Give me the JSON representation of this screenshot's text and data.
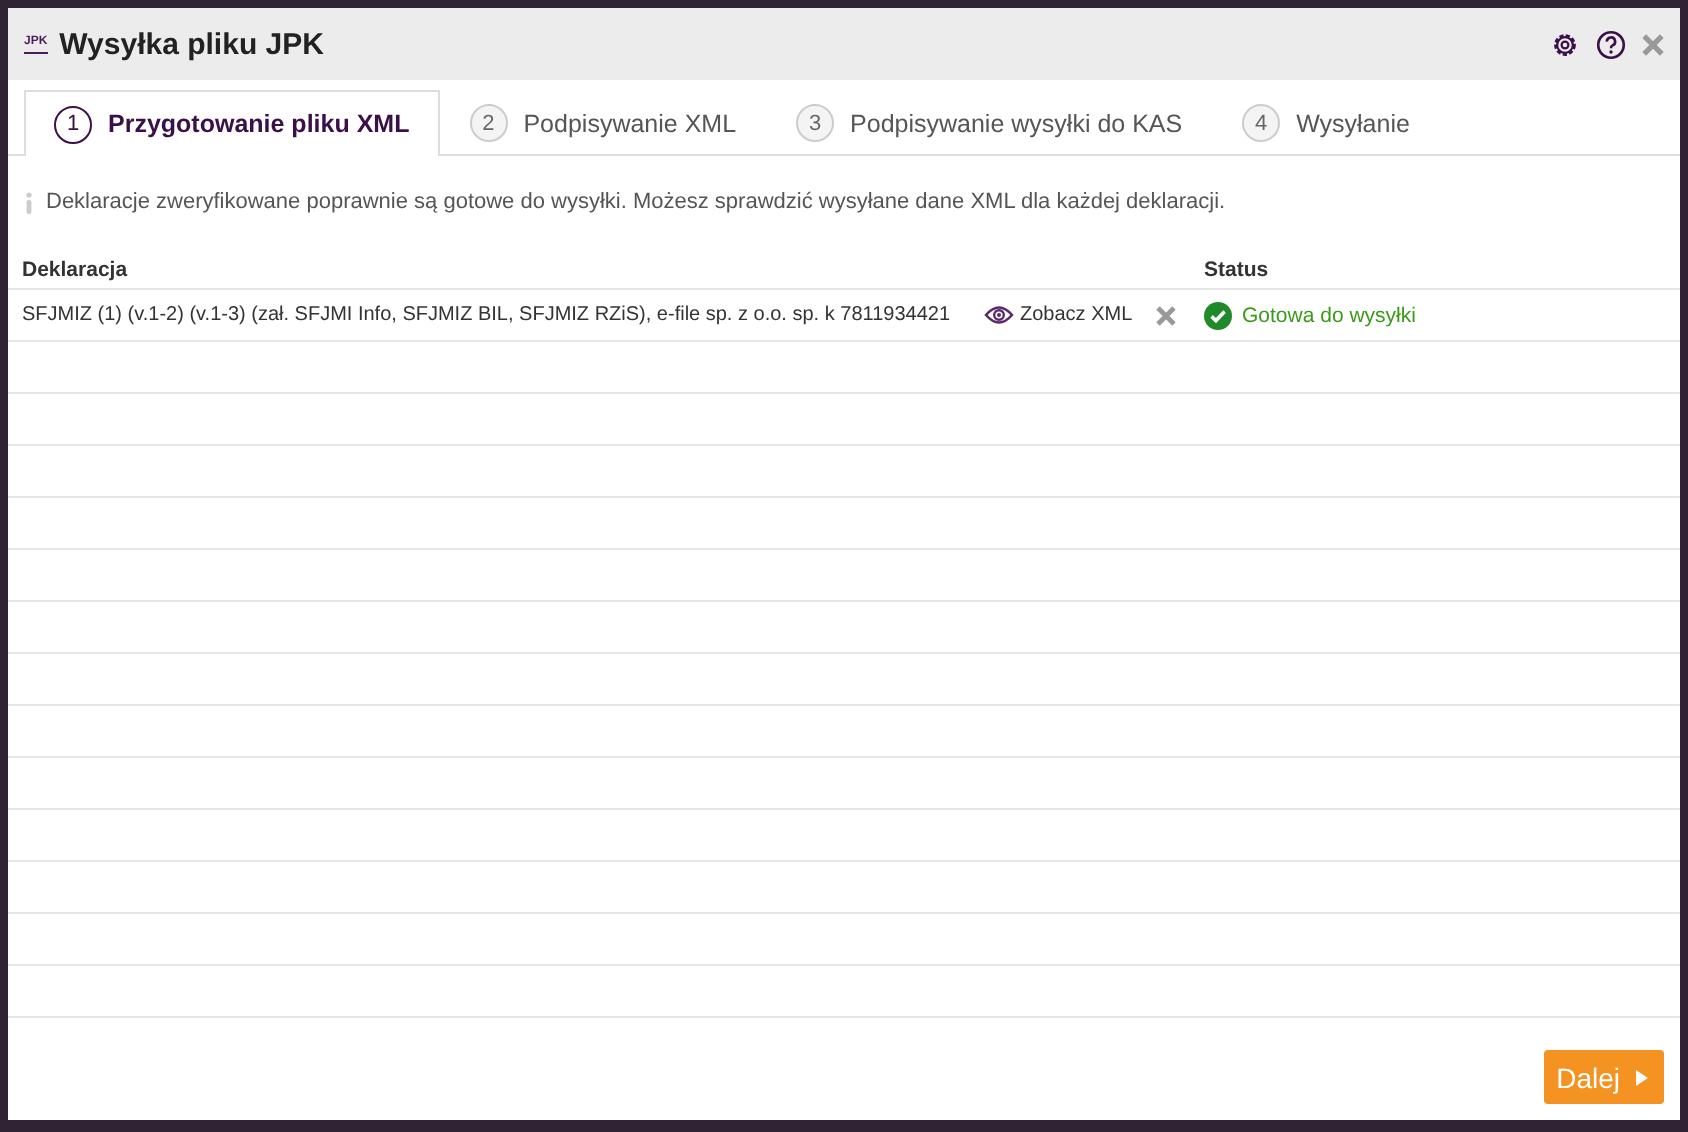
{
  "window": {
    "title": "Wysyłka pliku JPK",
    "logo": "JPK"
  },
  "tabs": [
    {
      "number": "1",
      "label": "Przygotowanie pliku XML",
      "selected": true
    },
    {
      "number": "2",
      "label": "Podpisywanie XML",
      "selected": false
    },
    {
      "number": "3",
      "label": "Podpisywanie wysyłki do KAS",
      "selected": false
    },
    {
      "number": "4",
      "label": "Wysyłanie",
      "selected": false
    }
  ],
  "info": "Deklaracje zweryfikowane poprawnie są gotowe do wysyłki. Możesz sprawdzić wysyłane dane XML dla każdej deklaracji.",
  "table": {
    "columns": [
      "Deklaracja",
      "Status"
    ],
    "rows": [
      {
        "declaration": "SFJMIZ (1) (v.1-2) (v.1-3) (zał. SFJMI Info, SFJMIZ BIL, SFJMIZ RZiS), e-file sp. z o.o. sp. k 7811934421",
        "view_link": "Zobacz XML",
        "status": "Gotowa do wysyłki",
        "kind": "ready"
      }
    ]
  },
  "next_button": "Dalej"
}
